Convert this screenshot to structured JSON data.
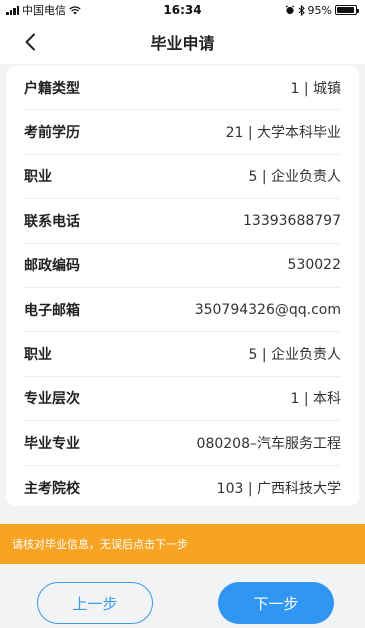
{
  "status_bar": {
    "carrier": "中国电信",
    "time": "16:34",
    "battery": "95%",
    "battery_level": 0.95
  },
  "nav": {
    "title": "毕业申请"
  },
  "rows": [
    {
      "label": "户籍类型",
      "value": "1 | 城镇"
    },
    {
      "label": "考前学历",
      "value": "21 | 大学本科毕业"
    },
    {
      "label": "职业",
      "value": "5 | 企业负责人"
    },
    {
      "label": "联系电话",
      "value": "13393688797"
    },
    {
      "label": "邮政编码",
      "value": "530022"
    },
    {
      "label": "电子邮箱",
      "value": "350794326@qq.com"
    },
    {
      "label": "职业",
      "value": "5 | 企业负责人"
    },
    {
      "label": "专业层次",
      "value": "1 | 本科"
    },
    {
      "label": "毕业专业",
      "value": "080208–汽车服务工程"
    },
    {
      "label": "主考院校",
      "value": "103 | 广西科技大学"
    }
  ],
  "notice": "请核对毕业信息，无误后点击下一步",
  "buttons": {
    "prev": "上一步",
    "next": "下一步"
  },
  "colors": {
    "accent": "#2f96f3",
    "notice_bg": "#f7a425"
  }
}
